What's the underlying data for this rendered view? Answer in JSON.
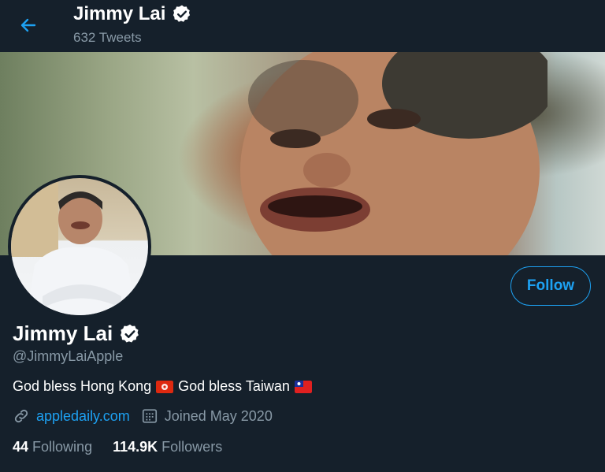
{
  "header": {
    "name": "Jimmy Lai",
    "tweet_count": "632 Tweets"
  },
  "profile": {
    "display_name": "Jimmy Lai",
    "handle": "@JimmyLaiApple",
    "follow_label": "Follow",
    "bio": {
      "part1": "God bless Hong Kong",
      "part2": "God bless Taiwan"
    },
    "website": "appledaily.com",
    "joined": "Joined May 2020",
    "following": {
      "count": "44",
      "label": "Following"
    },
    "followers": {
      "count": "114.9K",
      "label": "Followers"
    }
  },
  "colors": {
    "background": "#15202b",
    "accent": "#1da1f2",
    "muted": "#8899a6"
  },
  "icons": [
    "back-arrow-icon",
    "verified-badge-icon",
    "link-icon",
    "calendar-icon",
    "hong-kong-flag-icon",
    "taiwan-flag-icon"
  ]
}
